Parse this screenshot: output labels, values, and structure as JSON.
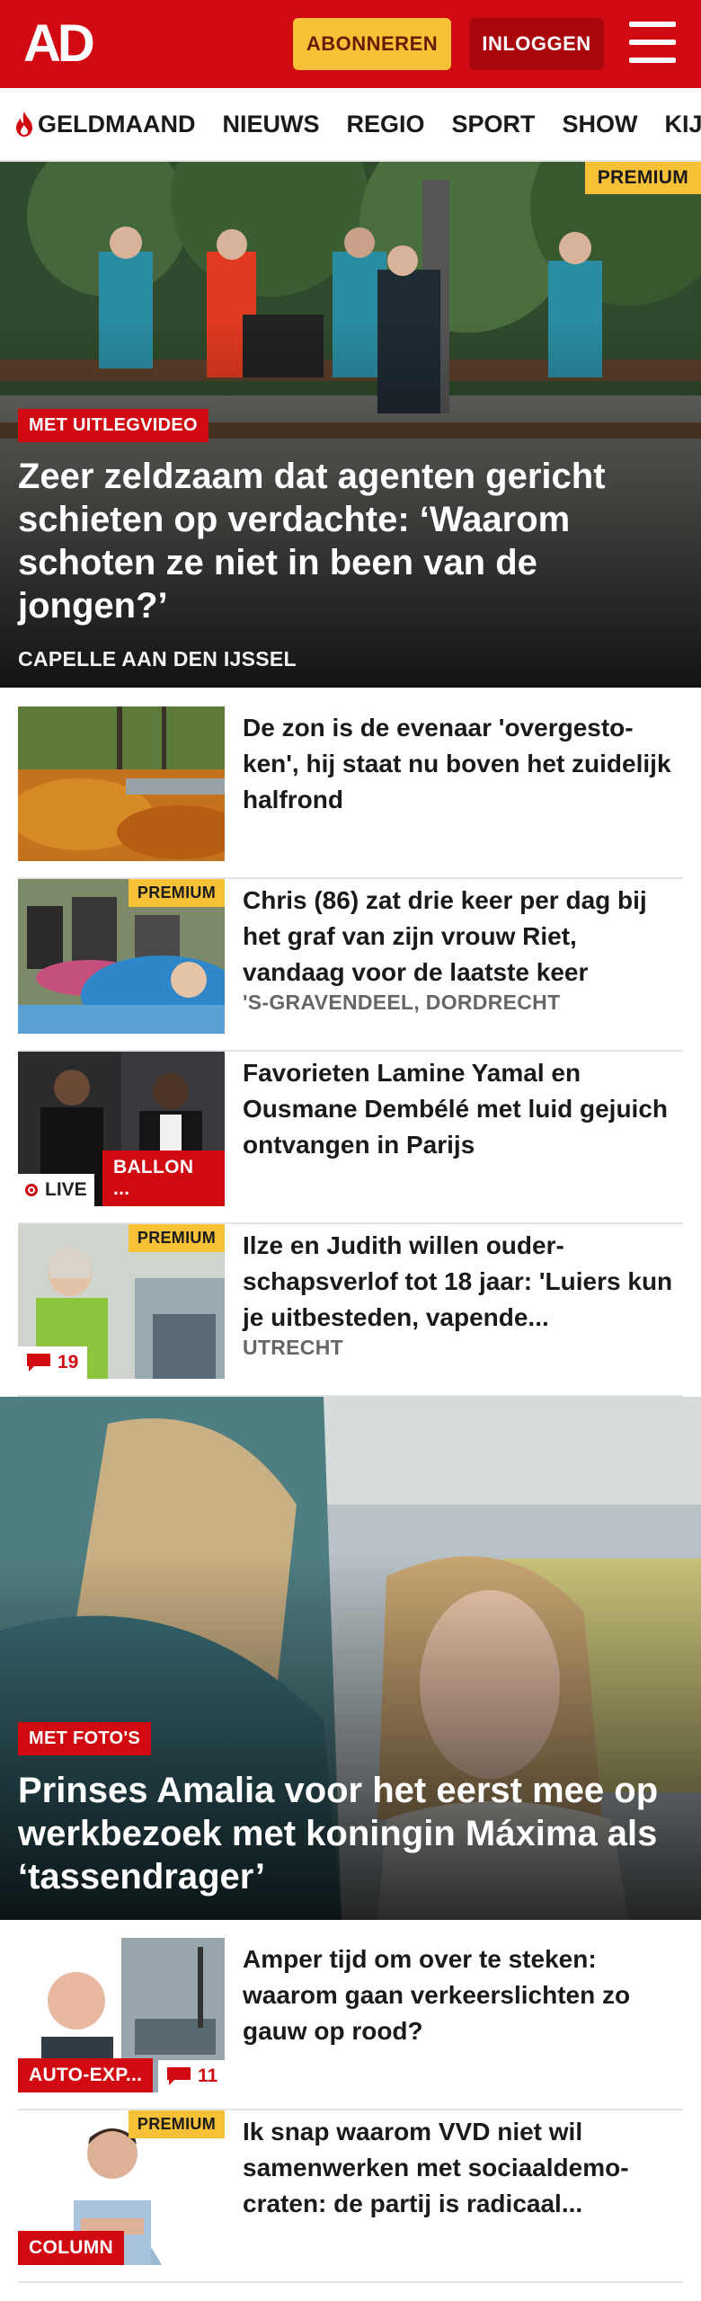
{
  "header": {
    "logo": "AD",
    "subscribe_label": "ABONNEREN",
    "login_label": "INLOGGEN",
    "colors": {
      "brand": "#d10a11",
      "subscribe": "#f6c137"
    }
  },
  "nav": {
    "items": [
      "GELDMAAND",
      "NIEUWS",
      "REGIO",
      "SPORT",
      "SHOW",
      "KIJK"
    ]
  },
  "hero1": {
    "badge": "PREMIUM",
    "tag": "MET UITLEGVIDEO",
    "title": "Zeer zeldzaam dat agenten gericht schieten op verdachte: ‘Waarom schoten ze niet in been van de jongen?’",
    "location": "CAPELLE AAN DEN IJSSEL"
  },
  "list1": [
    {
      "title": "De zon is de evenaar 'overgesto-ken', hij staat nu boven het zuidelijk halfrond",
      "meta": ""
    },
    {
      "badge": "PREMIUM",
      "title": "Chris (86) zat drie keer per dag bij het graf van zijn vrouw Riet, vandaag voor de laatste keer",
      "meta": "'S-GRAVENDEEL, DORDRECHT"
    },
    {
      "live": "LIVE",
      "category": "BALLON ...",
      "title": "Favorieten Lamine Yamal en Ousmane Dembélé met luid gejuich ontvangen in Parijs",
      "meta": ""
    },
    {
      "badge": "PREMIUM",
      "comments": "19",
      "title": "Ilze en Judith willen ouder-schapsverlof tot 18 jaar: 'Luiers kun je uitbesteden, vapende...",
      "meta": "UTRECHT"
    }
  ],
  "hero2": {
    "tag": "MET FOTO'S",
    "title": "Prinses Amalia voor het eerst mee op werkbezoek met koningin Máxima als ‘tassendrager’"
  },
  "list2": [
    {
      "category": "AUTO-EXP...",
      "comments": "11",
      "title": "Amper tijd om over te steken: waarom gaan verkeerslichten zo gauw op rood?"
    },
    {
      "badge": "PREMIUM",
      "category": "COLUMN",
      "title": "Ik snap waarom VVD niet wil samenwerken met sociaaldemo-craten: de partij is radicaal..."
    }
  ]
}
